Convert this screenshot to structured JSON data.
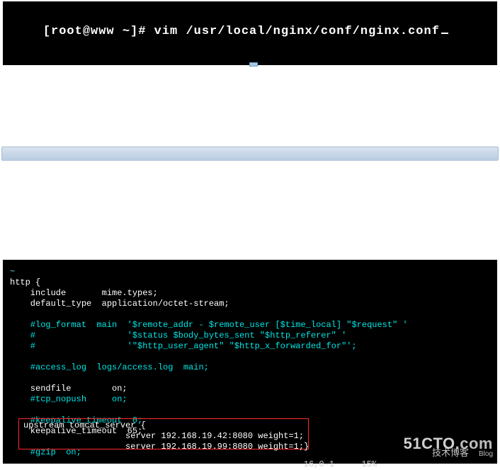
{
  "top_terminal": {
    "prompt": "[root@www ~]# ",
    "command": "vim /usr/local/nginx/conf/nginx.conf"
  },
  "config": {
    "pre_tilde": "~",
    "http_open": "http {",
    "include_kw": "    include       ",
    "include_val": "mime.types;",
    "deftype_kw": "    default_type  ",
    "deftype_val": "application/octet-stream;",
    "logfmt1": "    #log_format  main  '$remote_addr - $remote_user [$time_local] \"$request\" '",
    "logfmt2": "    #                  '$status $body_bytes_sent \"$http_referer\" '",
    "logfmt3": "    #                  '\"$http_user_agent\" \"$http_x_forwarded_for\"';",
    "access_log": "    #access_log  logs/access.log  main;",
    "sendfile_kw": "    sendfile        ",
    "sendfile_val": "on;",
    "tcp_nopush": "    #tcp_nopush     on;",
    "keep0": "    #keepalive_timeout  0;",
    "keep_kw": "    keepalive_timeout  ",
    "keep_val": "65;",
    "gzip": "    #gzip  on;",
    "upstream_open": "upstream tomcat_server {",
    "srv1": "                    server 192.168.19.42:8080 weight=1;",
    "srv2": "                    server 192.168.19.99:8080 weight=1;}"
  },
  "status": {
    "position": "16,0-1",
    "percent": "15%"
  },
  "watermark": {
    "brand": "51CTO",
    "suffix": ".com",
    "tagline": "技术博客",
    "blog": "Blog"
  }
}
